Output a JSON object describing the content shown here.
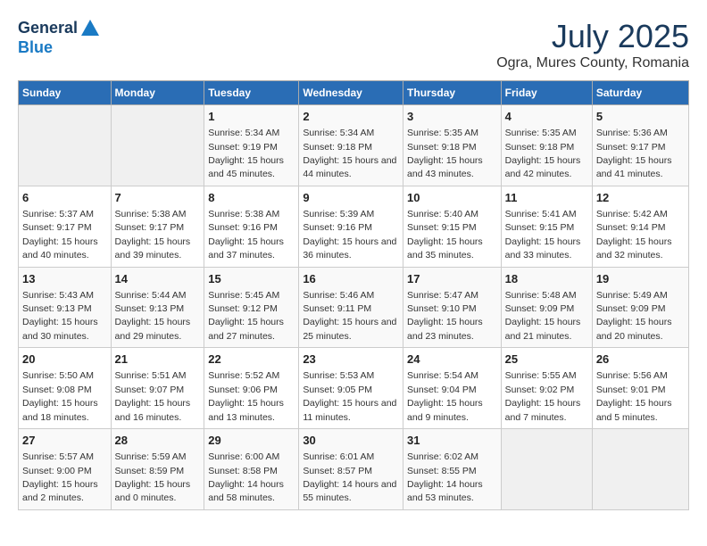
{
  "header": {
    "logo_line1": "General",
    "logo_line2": "Blue",
    "title": "July 2025",
    "subtitle": "Ogra, Mures County, Romania"
  },
  "calendar": {
    "days_of_week": [
      "Sunday",
      "Monday",
      "Tuesday",
      "Wednesday",
      "Thursday",
      "Friday",
      "Saturday"
    ],
    "weeks": [
      [
        {
          "day": "",
          "empty": true
        },
        {
          "day": "",
          "empty": true
        },
        {
          "day": "1",
          "sunrise": "Sunrise: 5:34 AM",
          "sunset": "Sunset: 9:19 PM",
          "daylight": "Daylight: 15 hours and 45 minutes."
        },
        {
          "day": "2",
          "sunrise": "Sunrise: 5:34 AM",
          "sunset": "Sunset: 9:18 PM",
          "daylight": "Daylight: 15 hours and 44 minutes."
        },
        {
          "day": "3",
          "sunrise": "Sunrise: 5:35 AM",
          "sunset": "Sunset: 9:18 PM",
          "daylight": "Daylight: 15 hours and 43 minutes."
        },
        {
          "day": "4",
          "sunrise": "Sunrise: 5:35 AM",
          "sunset": "Sunset: 9:18 PM",
          "daylight": "Daylight: 15 hours and 42 minutes."
        },
        {
          "day": "5",
          "sunrise": "Sunrise: 5:36 AM",
          "sunset": "Sunset: 9:17 PM",
          "daylight": "Daylight: 15 hours and 41 minutes."
        }
      ],
      [
        {
          "day": "6",
          "sunrise": "Sunrise: 5:37 AM",
          "sunset": "Sunset: 9:17 PM",
          "daylight": "Daylight: 15 hours and 40 minutes."
        },
        {
          "day": "7",
          "sunrise": "Sunrise: 5:38 AM",
          "sunset": "Sunset: 9:17 PM",
          "daylight": "Daylight: 15 hours and 39 minutes."
        },
        {
          "day": "8",
          "sunrise": "Sunrise: 5:38 AM",
          "sunset": "Sunset: 9:16 PM",
          "daylight": "Daylight: 15 hours and 37 minutes."
        },
        {
          "day": "9",
          "sunrise": "Sunrise: 5:39 AM",
          "sunset": "Sunset: 9:16 PM",
          "daylight": "Daylight: 15 hours and 36 minutes."
        },
        {
          "day": "10",
          "sunrise": "Sunrise: 5:40 AM",
          "sunset": "Sunset: 9:15 PM",
          "daylight": "Daylight: 15 hours and 35 minutes."
        },
        {
          "day": "11",
          "sunrise": "Sunrise: 5:41 AM",
          "sunset": "Sunset: 9:15 PM",
          "daylight": "Daylight: 15 hours and 33 minutes."
        },
        {
          "day": "12",
          "sunrise": "Sunrise: 5:42 AM",
          "sunset": "Sunset: 9:14 PM",
          "daylight": "Daylight: 15 hours and 32 minutes."
        }
      ],
      [
        {
          "day": "13",
          "sunrise": "Sunrise: 5:43 AM",
          "sunset": "Sunset: 9:13 PM",
          "daylight": "Daylight: 15 hours and 30 minutes."
        },
        {
          "day": "14",
          "sunrise": "Sunrise: 5:44 AM",
          "sunset": "Sunset: 9:13 PM",
          "daylight": "Daylight: 15 hours and 29 minutes."
        },
        {
          "day": "15",
          "sunrise": "Sunrise: 5:45 AM",
          "sunset": "Sunset: 9:12 PM",
          "daylight": "Daylight: 15 hours and 27 minutes."
        },
        {
          "day": "16",
          "sunrise": "Sunrise: 5:46 AM",
          "sunset": "Sunset: 9:11 PM",
          "daylight": "Daylight: 15 hours and 25 minutes."
        },
        {
          "day": "17",
          "sunrise": "Sunrise: 5:47 AM",
          "sunset": "Sunset: 9:10 PM",
          "daylight": "Daylight: 15 hours and 23 minutes."
        },
        {
          "day": "18",
          "sunrise": "Sunrise: 5:48 AM",
          "sunset": "Sunset: 9:09 PM",
          "daylight": "Daylight: 15 hours and 21 minutes."
        },
        {
          "day": "19",
          "sunrise": "Sunrise: 5:49 AM",
          "sunset": "Sunset: 9:09 PM",
          "daylight": "Daylight: 15 hours and 20 minutes."
        }
      ],
      [
        {
          "day": "20",
          "sunrise": "Sunrise: 5:50 AM",
          "sunset": "Sunset: 9:08 PM",
          "daylight": "Daylight: 15 hours and 18 minutes."
        },
        {
          "day": "21",
          "sunrise": "Sunrise: 5:51 AM",
          "sunset": "Sunset: 9:07 PM",
          "daylight": "Daylight: 15 hours and 16 minutes."
        },
        {
          "day": "22",
          "sunrise": "Sunrise: 5:52 AM",
          "sunset": "Sunset: 9:06 PM",
          "daylight": "Daylight: 15 hours and 13 minutes."
        },
        {
          "day": "23",
          "sunrise": "Sunrise: 5:53 AM",
          "sunset": "Sunset: 9:05 PM",
          "daylight": "Daylight: 15 hours and 11 minutes."
        },
        {
          "day": "24",
          "sunrise": "Sunrise: 5:54 AM",
          "sunset": "Sunset: 9:04 PM",
          "daylight": "Daylight: 15 hours and 9 minutes."
        },
        {
          "day": "25",
          "sunrise": "Sunrise: 5:55 AM",
          "sunset": "Sunset: 9:02 PM",
          "daylight": "Daylight: 15 hours and 7 minutes."
        },
        {
          "day": "26",
          "sunrise": "Sunrise: 5:56 AM",
          "sunset": "Sunset: 9:01 PM",
          "daylight": "Daylight: 15 hours and 5 minutes."
        }
      ],
      [
        {
          "day": "27",
          "sunrise": "Sunrise: 5:57 AM",
          "sunset": "Sunset: 9:00 PM",
          "daylight": "Daylight: 15 hours and 2 minutes."
        },
        {
          "day": "28",
          "sunrise": "Sunrise: 5:59 AM",
          "sunset": "Sunset: 8:59 PM",
          "daylight": "Daylight: 15 hours and 0 minutes."
        },
        {
          "day": "29",
          "sunrise": "Sunrise: 6:00 AM",
          "sunset": "Sunset: 8:58 PM",
          "daylight": "Daylight: 14 hours and 58 minutes."
        },
        {
          "day": "30",
          "sunrise": "Sunrise: 6:01 AM",
          "sunset": "Sunset: 8:57 PM",
          "daylight": "Daylight: 14 hours and 55 minutes."
        },
        {
          "day": "31",
          "sunrise": "Sunrise: 6:02 AM",
          "sunset": "Sunset: 8:55 PM",
          "daylight": "Daylight: 14 hours and 53 minutes."
        },
        {
          "day": "",
          "empty": true
        },
        {
          "day": "",
          "empty": true
        }
      ]
    ]
  }
}
